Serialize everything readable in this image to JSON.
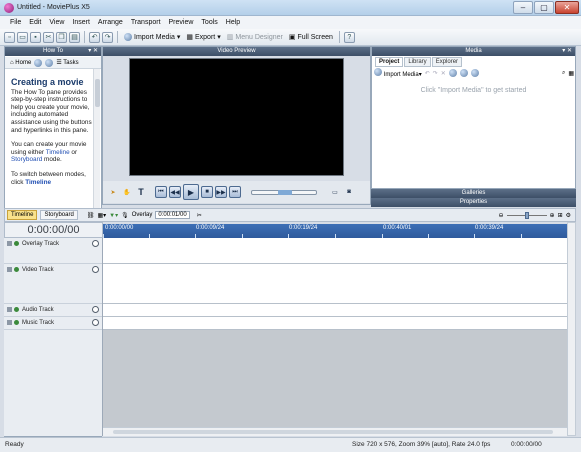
{
  "window": {
    "title": "Untitled - MoviePlus X5"
  },
  "menu": [
    "File",
    "Edit",
    "View",
    "Insert",
    "Arrange",
    "Transport",
    "Preview",
    "Tools",
    "Help"
  ],
  "toolbar": {
    "import_media": "Import Media",
    "export": "Export",
    "menu_designer": "Menu Designer",
    "full_screen": "Full Screen"
  },
  "howto": {
    "pane_title": "How To",
    "home": "Home",
    "tasks": "Tasks",
    "heading": "Creating a movie",
    "p1": "The How To pane provides step-by-step instructions to help you create your movie, including automated assistance using the buttons and hyperlinks in this pane.",
    "p2_a": "You can create your movie using either",
    "p2_link1": "Timeline",
    "p2_b": "or",
    "p2_link2": "Storyboard",
    "p2_c": "mode.",
    "p3_a": "To switch between modes, click",
    "p3_b": "Timeline"
  },
  "video_preview": {
    "pane_title": "Video Preview"
  },
  "media": {
    "pane_title": "Media",
    "tabs": [
      "Project",
      "Library",
      "Explorer"
    ],
    "import_media": "Import Media",
    "empty_hint": "Click \"Import Media\" to get started"
  },
  "galleries": {
    "title": "Galleries"
  },
  "properties": {
    "title": "Properties"
  },
  "timeline": {
    "tabs": [
      "Timeline",
      "Storyboard"
    ],
    "overlay_label": "Overlay",
    "overlay_value": "0:00:01/00",
    "timecode": "0:00:00/00",
    "ruler_labels": [
      "0:00:00/00",
      "0:00:09/24",
      "0:00:19/24",
      "0:00:40/01",
      "0:00:39/24",
      "0:01:20/01"
    ],
    "tracks": [
      "Overlay Track",
      "Video Track",
      "Audio Track",
      "Music Track"
    ]
  },
  "status": {
    "ready": "Ready",
    "info": "Size 720 x 576, Zoom 39% [auto], Rate 24.0 fps",
    "timecode": "0:00:00/00"
  }
}
